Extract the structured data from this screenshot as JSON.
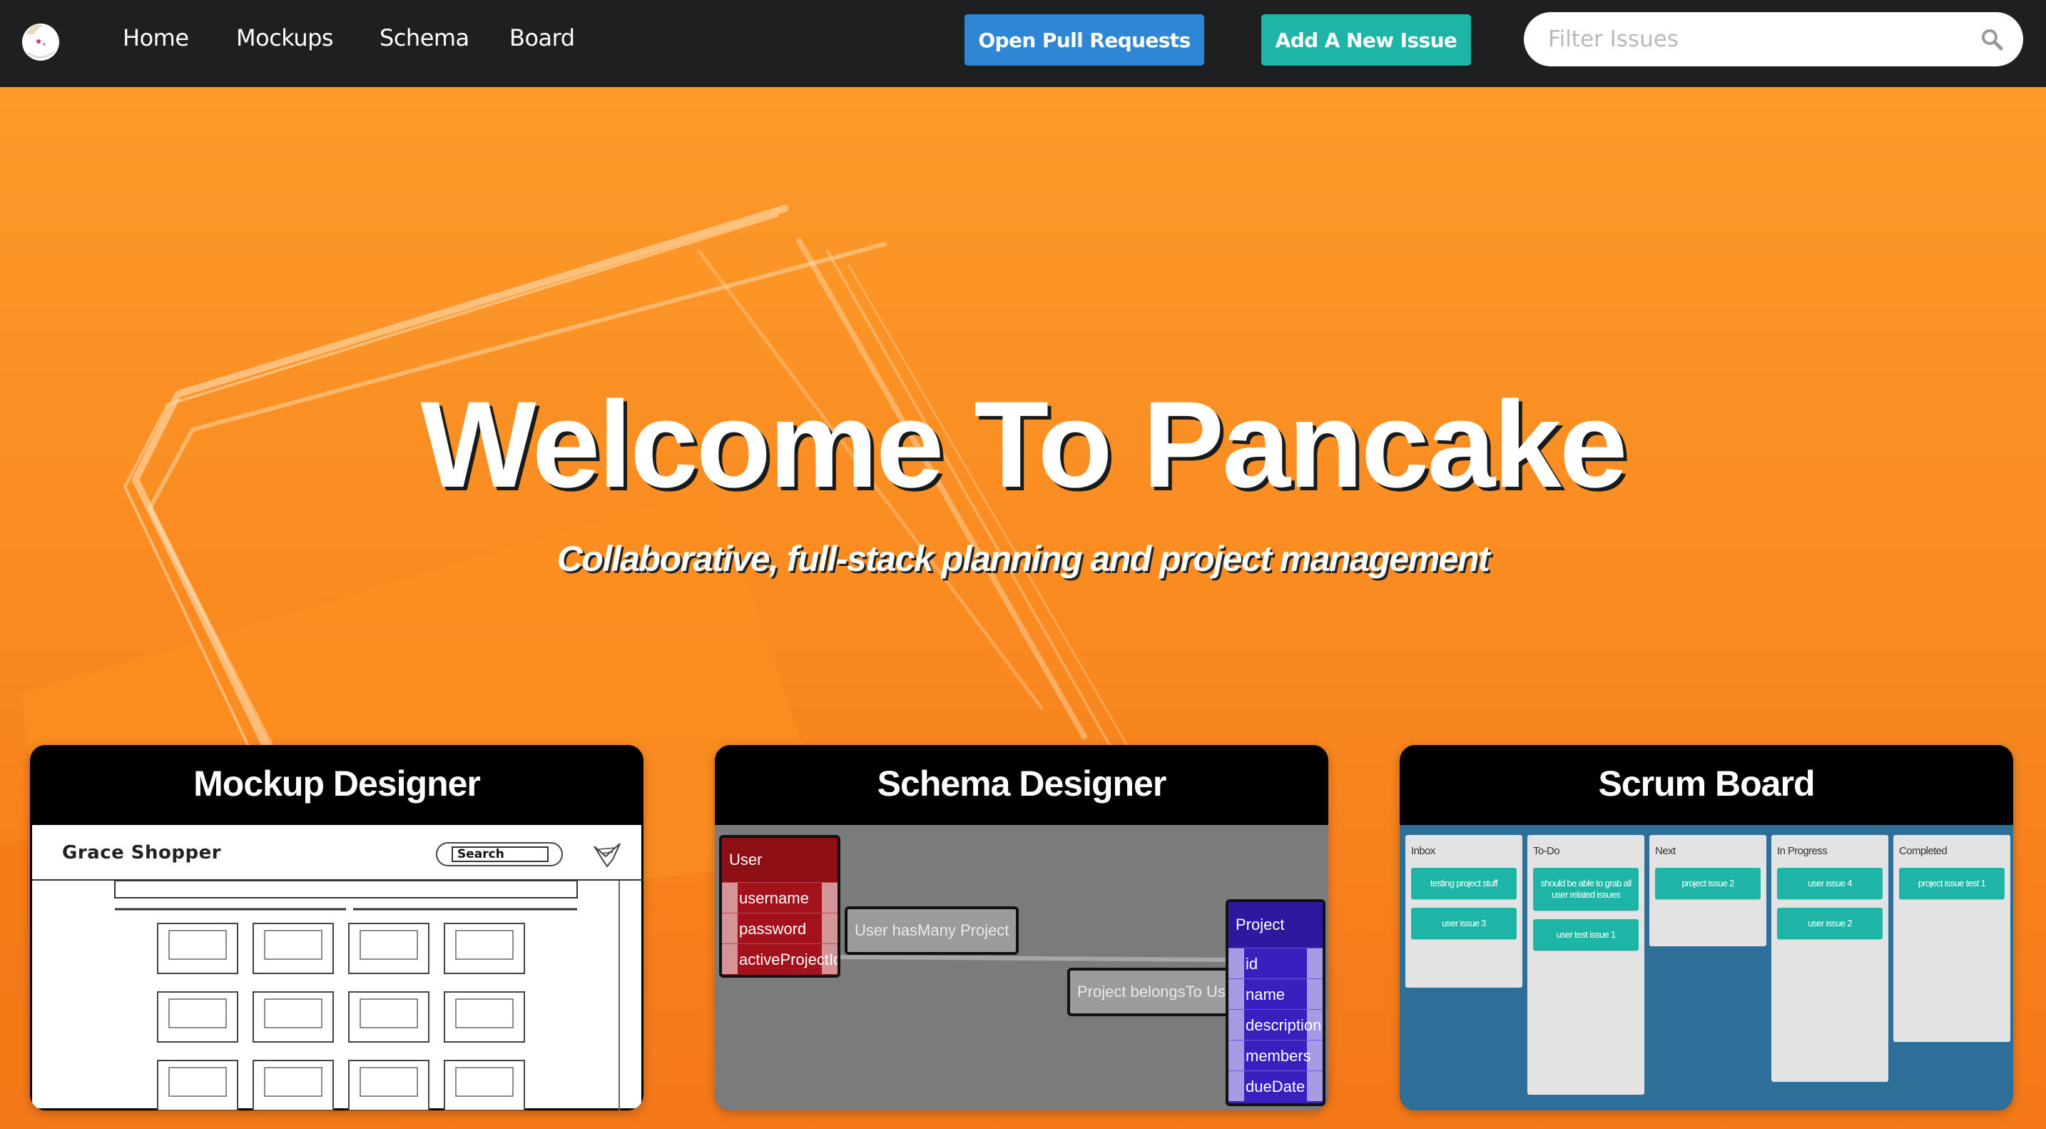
{
  "nav": {
    "links": [
      "Home",
      "Mockups",
      "Schema",
      "Board"
    ],
    "open_prs_label": "Open Pull Requests",
    "add_issue_label": "Add A New Issue",
    "search_placeholder": "Filter Issues"
  },
  "hero": {
    "title": "Welcome To Pancake",
    "tagline": "Collaborative, full-stack planning and project management"
  },
  "cards": [
    {
      "title": "Mockup Designer"
    },
    {
      "title": "Schema Designer"
    },
    {
      "title": "Scrum Board"
    }
  ],
  "mockup": {
    "store_name": "Grace Shopper",
    "search_label": "Search"
  },
  "schema": {
    "user_table": {
      "name": "User",
      "fields": [
        "username",
        "password",
        "activeProjectId"
      ]
    },
    "project_table": {
      "name": "Project",
      "fields": [
        "id",
        "name",
        "description",
        "members",
        "dueDate"
      ]
    },
    "relations": [
      "User hasMany Project",
      "Project belongsTo User"
    ]
  },
  "scrum": {
    "columns": [
      {
        "title": "Inbox",
        "tasks": [
          "testing project stuff",
          "user issue 3"
        ]
      },
      {
        "title": "To-Do",
        "tasks": [
          "should be able to grab all user related issues",
          "user test issue 1"
        ]
      },
      {
        "title": "Next",
        "tasks": [
          "project issue 2"
        ]
      },
      {
        "title": "In Progress",
        "tasks": [
          "user issue 4",
          "user issue 2"
        ]
      },
      {
        "title": "Completed",
        "tasks": [
          "project issue test 1"
        ]
      }
    ]
  },
  "colors": {
    "navbar": "#1d1f21",
    "hero_orange": "#f7861c",
    "prs_button": "#2f86d5",
    "issue_button": "#1fb5a6",
    "user_table": "#a3121b",
    "project_table": "#3a1fbf",
    "scrum_background": "#2e6f9a"
  }
}
